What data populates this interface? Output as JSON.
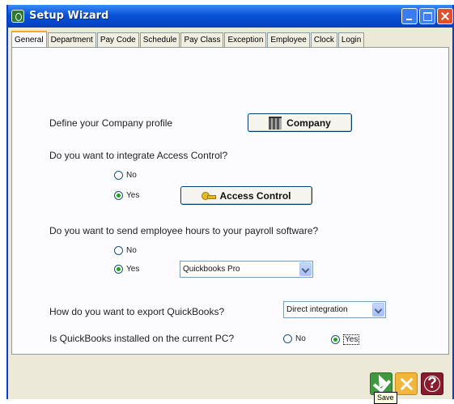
{
  "window": {
    "title": "Setup Wizard"
  },
  "tabs": [
    {
      "label": "General",
      "active": true
    },
    {
      "label": "Department"
    },
    {
      "label": "Pay Code"
    },
    {
      "label": "Schedule"
    },
    {
      "label": "Pay Class"
    },
    {
      "label": "Exception"
    },
    {
      "label": "Employee"
    },
    {
      "label": "Clock"
    },
    {
      "label": "Login"
    }
  ],
  "company": {
    "prompt": "Define your Company profile",
    "button_label": "Company"
  },
  "access_control": {
    "prompt": "Do you want to integrate Access Control?",
    "no_label": "No",
    "yes_label": "Yes",
    "selected": "Yes",
    "button_label": "Access Control"
  },
  "payroll": {
    "prompt": "Do you want to send employee hours to your payroll software?",
    "no_label": "No",
    "yes_label": "Yes",
    "selected": "Yes",
    "software_value": "Quickbooks Pro"
  },
  "export": {
    "prompt": "How do you want to export QuickBooks?",
    "value": "Direct integration"
  },
  "installed": {
    "prompt": "Is QuickBooks installed on the current PC?",
    "no_label": "No",
    "yes_label": "Yes",
    "selected": "Yes"
  },
  "toolbar": {
    "help_label": "?",
    "save_tooltip": "Save"
  },
  "icons": [
    "building-icon",
    "key-icon",
    "save-icon",
    "cancel-icon",
    "help-icon"
  ]
}
